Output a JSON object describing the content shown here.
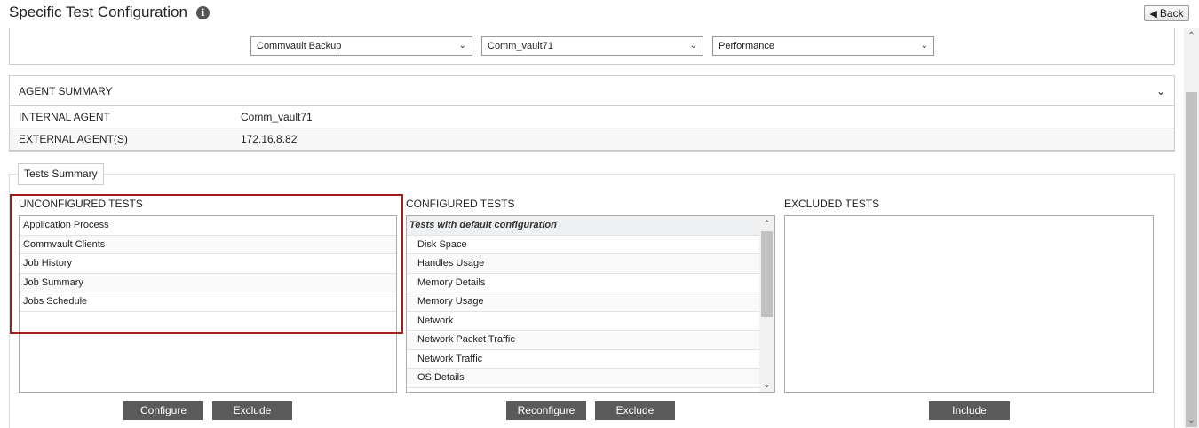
{
  "header": {
    "title": "Specific Test Configuration",
    "info_icon": "info-icon",
    "back_label": "Back",
    "back_icon": "back-arrow-icon"
  },
  "config": {
    "selects": [
      {
        "value": "Commvault Backup"
      },
      {
        "value": "Comm_vault71"
      },
      {
        "value": "Performance"
      }
    ]
  },
  "agent_summary": {
    "title": "AGENT SUMMARY",
    "rows": [
      {
        "label": "INTERNAL AGENT",
        "value": "Comm_vault71"
      },
      {
        "label": "EXTERNAL AGENT(S)",
        "value": "172.16.8.82"
      }
    ]
  },
  "tests_summary": {
    "tab_label": "Tests Summary",
    "unconfigured": {
      "title": "UNCONFIGURED TESTS",
      "items": [
        "Application Process",
        "Commvault Clients",
        "Job History",
        "Job Summary",
        "Jobs Schedule"
      ],
      "buttons": {
        "configure": "Configure",
        "exclude": "Exclude"
      }
    },
    "configured": {
      "title": "CONFIGURED TESTS",
      "group_label": "Tests with default configuration",
      "items": [
        "Disk Space",
        "Handles Usage",
        "Memory Details",
        "Memory Usage",
        "Network",
        "Network Packet Traffic",
        "Network Traffic",
        "OS Details"
      ],
      "buttons": {
        "reconfigure": "Reconfigure",
        "exclude": "Exclude"
      }
    },
    "excluded": {
      "title": "EXCLUDED TESTS",
      "items": [],
      "buttons": {
        "include": "Include"
      }
    }
  },
  "colors": {
    "highlight": "#a31c1c",
    "button_bg": "#5a5a5a"
  }
}
